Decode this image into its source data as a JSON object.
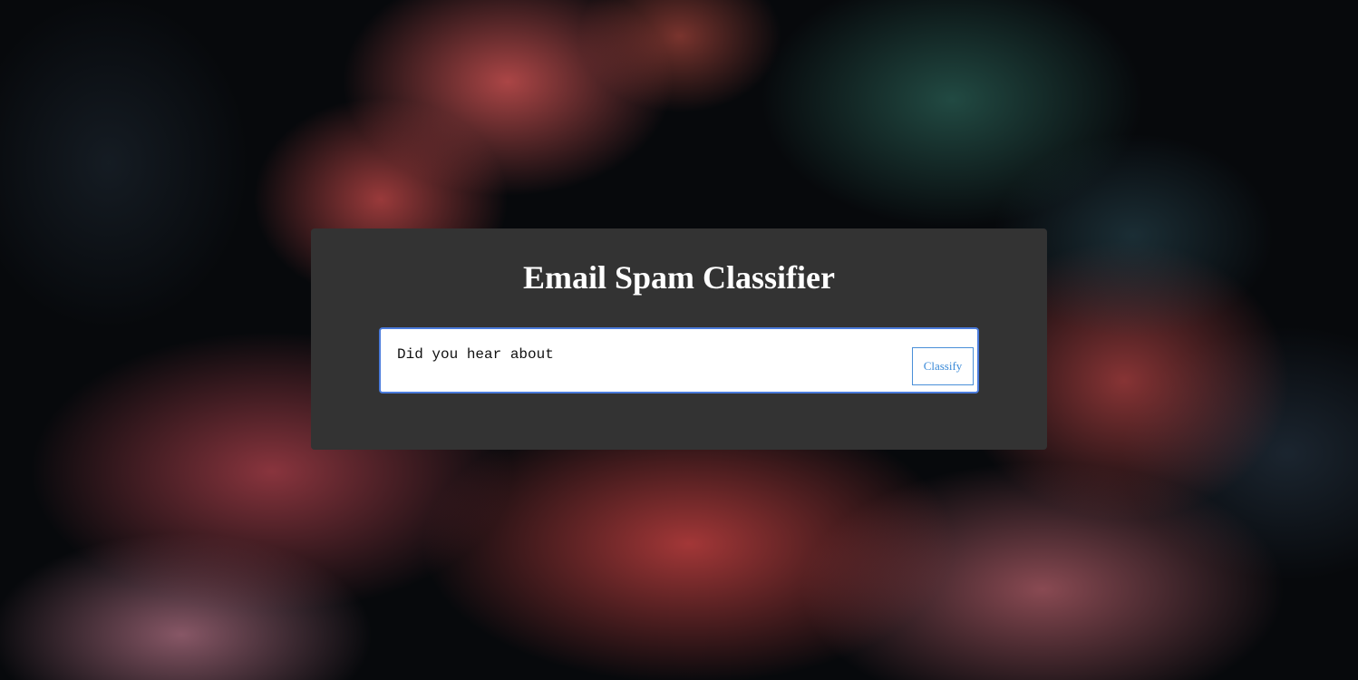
{
  "page": {
    "title": "Email Spam Classifier"
  },
  "form": {
    "email_value": "Did you hear about",
    "classify_label": "Classify"
  },
  "colors": {
    "card_background": "#333333",
    "input_border": "#4a7bdc",
    "button_text": "#3a8ad8",
    "title_text": "#ffffff"
  }
}
